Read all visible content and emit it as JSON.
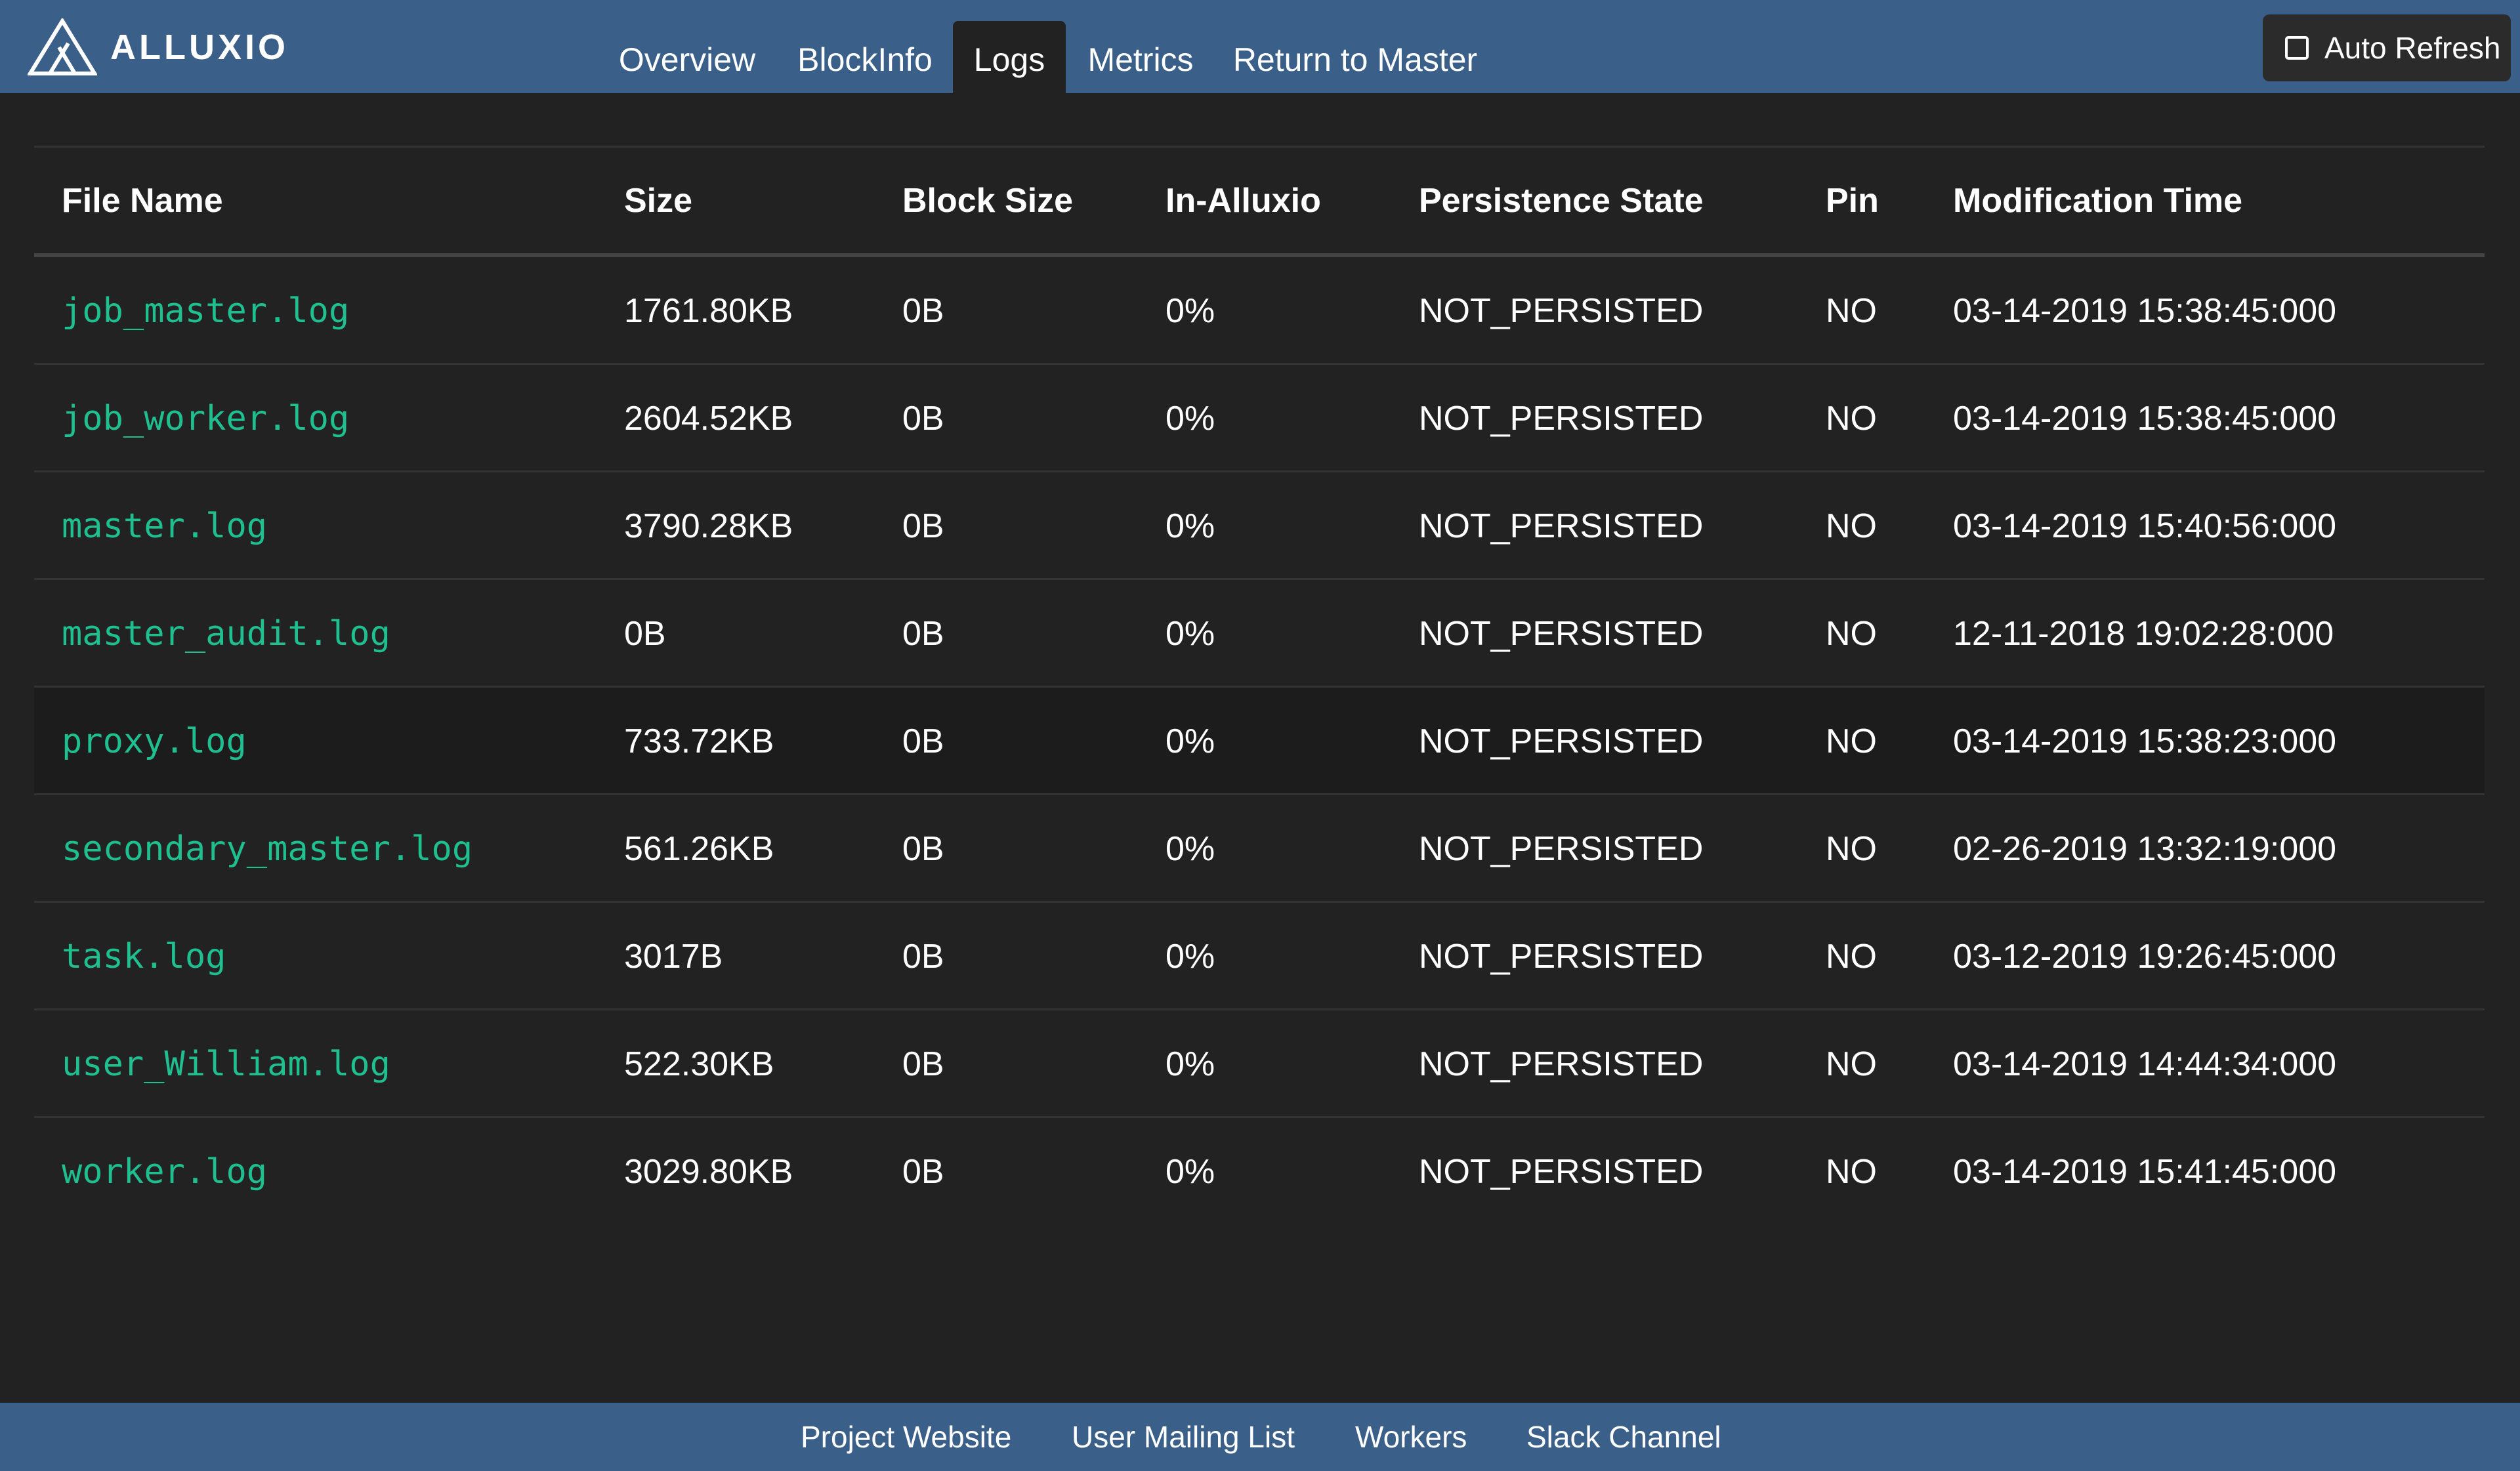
{
  "brand": {
    "name": "ALLUXIO",
    "logo_icon": "alluxio-logo-icon"
  },
  "nav": {
    "items": [
      {
        "label": "Overview",
        "active": false
      },
      {
        "label": "BlockInfo",
        "active": false
      },
      {
        "label": "Logs",
        "active": true
      },
      {
        "label": "Metrics",
        "active": false
      },
      {
        "label": "Return to Master",
        "active": false
      }
    ]
  },
  "auto_refresh": {
    "label": "Auto Refresh",
    "checked": false
  },
  "table": {
    "headers": [
      "File Name",
      "Size",
      "Block Size",
      "In-Alluxio",
      "Persistence State",
      "Pin",
      "Modification Time"
    ],
    "rows": [
      {
        "name": "job_master.log",
        "size": "1761.80KB",
        "block_size": "0B",
        "in_alluxio": "0%",
        "persistence": "NOT_PERSISTED",
        "pin": "NO",
        "modified": "03-14-2019 15:38:45:000"
      },
      {
        "name": "job_worker.log",
        "size": "2604.52KB",
        "block_size": "0B",
        "in_alluxio": "0%",
        "persistence": "NOT_PERSISTED",
        "pin": "NO",
        "modified": "03-14-2019 15:38:45:000"
      },
      {
        "name": "master.log",
        "size": "3790.28KB",
        "block_size": "0B",
        "in_alluxio": "0%",
        "persistence": "NOT_PERSISTED",
        "pin": "NO",
        "modified": "03-14-2019 15:40:56:000"
      },
      {
        "name": "master_audit.log",
        "size": "0B",
        "block_size": "0B",
        "in_alluxio": "0%",
        "persistence": "NOT_PERSISTED",
        "pin": "NO",
        "modified": "12-11-2018 19:02:28:000"
      },
      {
        "name": "proxy.log",
        "size": "733.72KB",
        "block_size": "0B",
        "in_alluxio": "0%",
        "persistence": "NOT_PERSISTED",
        "pin": "NO",
        "modified": "03-14-2019 15:38:23:000"
      },
      {
        "name": "secondary_master.log",
        "size": "561.26KB",
        "block_size": "0B",
        "in_alluxio": "0%",
        "persistence": "NOT_PERSISTED",
        "pin": "NO",
        "modified": "02-26-2019 13:32:19:000"
      },
      {
        "name": "task.log",
        "size": "3017B",
        "block_size": "0B",
        "in_alluxio": "0%",
        "persistence": "NOT_PERSISTED",
        "pin": "NO",
        "modified": "03-12-2019 19:26:45:000"
      },
      {
        "name": "user_William.log",
        "size": "522.30KB",
        "block_size": "0B",
        "in_alluxio": "0%",
        "persistence": "NOT_PERSISTED",
        "pin": "NO",
        "modified": "03-14-2019 14:44:34:000"
      },
      {
        "name": "worker.log",
        "size": "3029.80KB",
        "block_size": "0B",
        "in_alluxio": "0%",
        "persistence": "NOT_PERSISTED",
        "pin": "NO",
        "modified": "03-14-2019 15:41:45:000"
      }
    ]
  },
  "footer": {
    "links": [
      "Project Website",
      "User Mailing List",
      "Workers",
      "Slack Channel"
    ]
  },
  "colors": {
    "header_bg": "#3a5f89",
    "page_bg": "#222222",
    "link_green": "#1fbf8f"
  }
}
